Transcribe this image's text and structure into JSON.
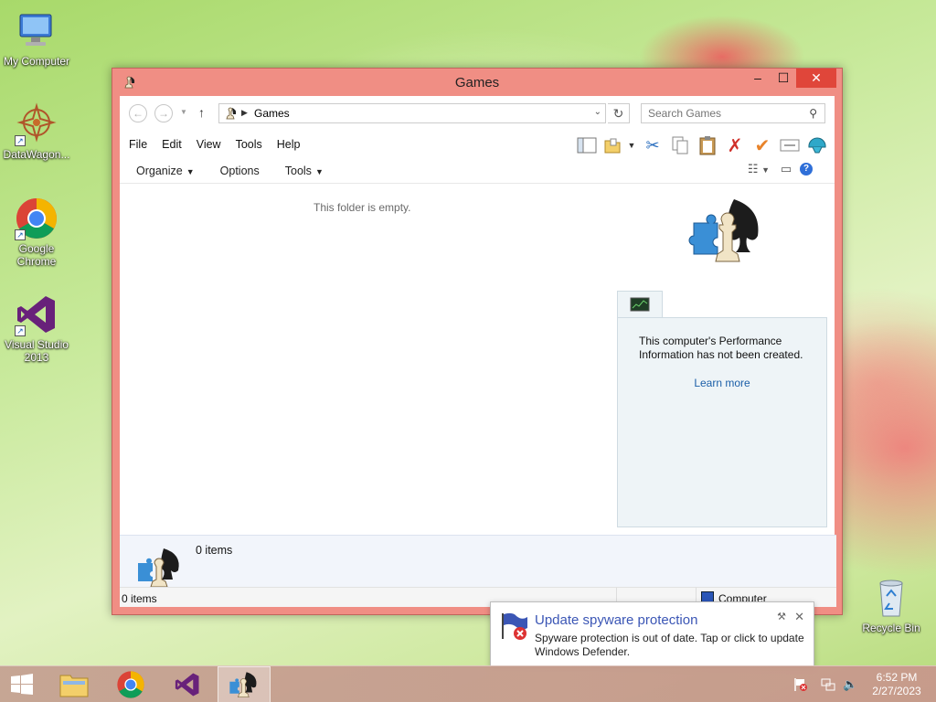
{
  "desktop": {
    "icons": [
      {
        "label": "My Computer"
      },
      {
        "label": "DataWagon..."
      },
      {
        "label": "Google Chrome"
      },
      {
        "label": "Visual Studio 2013"
      },
      {
        "label": "Recycle Bin"
      }
    ]
  },
  "window": {
    "title": "Games",
    "controls": {
      "minimize": "–",
      "maximize": "☐",
      "close": "✕"
    },
    "address": {
      "crumb": "Games"
    },
    "search": {
      "placeholder": "Search Games"
    },
    "menu": [
      "File",
      "Edit",
      "View",
      "Tools",
      "Help"
    ],
    "commands": [
      {
        "label": "Organize",
        "has_dropdown": true
      },
      {
        "label": "Options",
        "has_dropdown": false
      },
      {
        "label": "Tools",
        "has_dropdown": true
      }
    ],
    "empty_message": "This folder is empty.",
    "performance": {
      "message": "This computer's Performance Information has not been created.",
      "link": "Learn more"
    },
    "details_count": "0 items",
    "status": {
      "left": "0 items",
      "right": "Computer"
    }
  },
  "notification": {
    "title": "Update spyware protection",
    "body": "Spyware protection is out of date. Tap or click to update Windows Defender."
  },
  "taskbar": {
    "apps": [
      "File Explorer",
      "Google Chrome",
      "Visual Studio",
      "Games"
    ],
    "clock": {
      "time": "6:52 PM",
      "date": "2/27/2023"
    }
  },
  "colors": {
    "window_frame": "#f08e84",
    "close_button": "#e0463a",
    "link": "#1c5fa8",
    "notification_title": "#3b56b5"
  }
}
